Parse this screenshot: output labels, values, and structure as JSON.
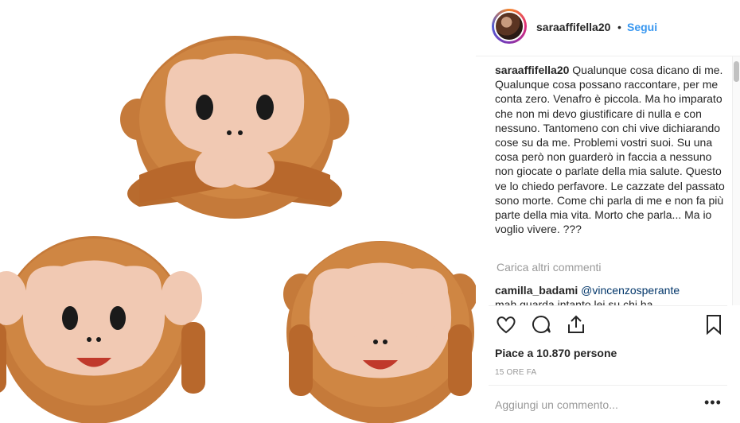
{
  "photo": {
    "alt": "three monkey emoji pillows"
  },
  "header": {
    "username": "saraaffifella20",
    "separator": "•",
    "follow_label": "Segui"
  },
  "caption": {
    "username": "saraaffifella20",
    "text": "Qualunque cosa dicano di me. Qualunque cosa possano raccontare, per me conta zero. Venafro è piccola. Ma ho imparato che non mi devo giustificare di nulla e con nessuno. Tantomeno con chi vive dichiarando cose su da me. Problemi vostri suoi. Su una cosa però non guarderò in faccia a nessuno non giocate o parlate della mia salute. Questo ve lo chiedo perfavore. Le cazzate del passato sono morte. Come chi parla di me e non fa più parte della mia vita. Morto che parla... Ma io voglio vivere. ???"
  },
  "load_more_label": "Carica altri commenti",
  "comment": {
    "username": "camilla_badami",
    "mention": "@vincenzosperante",
    "text": "mah guarda intanto lei su chi ha"
  },
  "likes_text": "Piace a 10.870 persone",
  "time_text": "15 ORE FA",
  "add_comment_placeholder": "Aggiungi un commento...",
  "more_options": "•••",
  "icons": [
    "heart-icon",
    "comment-icon",
    "share-icon",
    "bookmark-icon"
  ]
}
